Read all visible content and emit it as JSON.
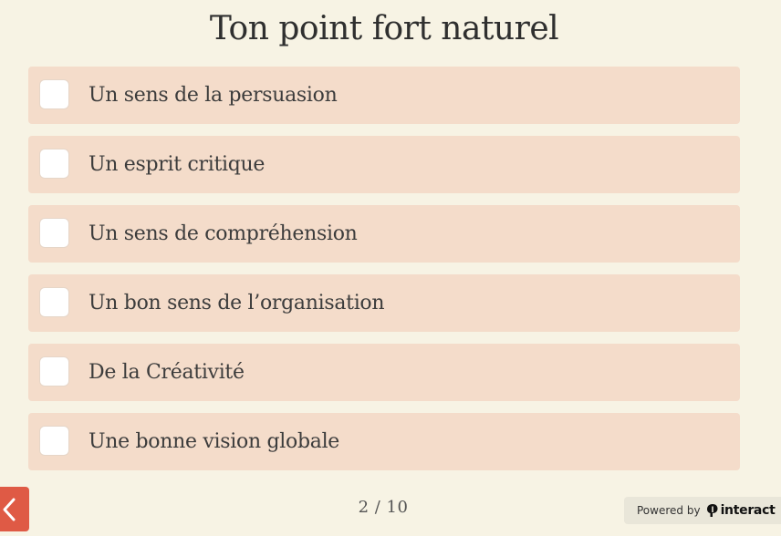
{
  "question": {
    "title": "Ton point fort naturel"
  },
  "options": [
    {
      "label": "Un sens de la persuasion",
      "checked": false
    },
    {
      "label": "Un esprit critique",
      "checked": false
    },
    {
      "label": "Un sens de compréhension",
      "checked": false
    },
    {
      "label": "Un bon sens de l’organisation",
      "checked": false
    },
    {
      "label": "De la Créativité",
      "checked": false
    },
    {
      "label": "Une bonne vision globale",
      "checked": false
    }
  ],
  "navigation": {
    "back_icon": "chevron-left-icon",
    "page_counter": "2 / 10"
  },
  "footer": {
    "powered_by_text": "Powered by",
    "brand_icon": "interact-logo-icon",
    "brand_name": "interact"
  },
  "colors": {
    "background": "#f7f3e4",
    "option_background": "#f4dcca",
    "accent": "#df5a45"
  }
}
